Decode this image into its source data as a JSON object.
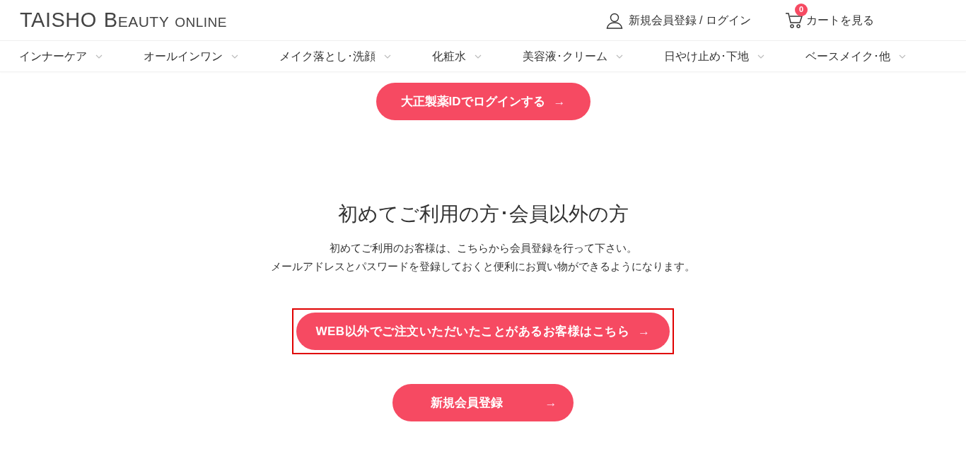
{
  "header": {
    "logo": {
      "main": "TAISHO",
      "beauty_initial": "B",
      "beauty_rest": "EAUTY",
      "online": "ONLINE"
    },
    "account_link": "新規会員登録 / ログイン",
    "cart": {
      "label": "カートを見る",
      "count": "0"
    }
  },
  "nav": [
    {
      "label": "インナーケア"
    },
    {
      "label": "オールインワン"
    },
    {
      "label": "メイク落とし･洗顔"
    },
    {
      "label": "化粧水"
    },
    {
      "label": "美容液･クリーム"
    },
    {
      "label": "日やけ止め･下地"
    },
    {
      "label": "ベースメイク･他"
    }
  ],
  "login_button": {
    "label": "大正製薬IDでログインする",
    "arrow": "→"
  },
  "guest_section": {
    "title": "初めてご利用の方･会員以外の方",
    "lines": [
      "初めてご利用のお客様は、こちらから会員登録を行って下さい。",
      "メールアドレスとパスワードを登録しておくと便利にお買い物ができるようになります。"
    ],
    "buttons": [
      {
        "label": "WEB以外でご注文いただいたことがあるお客様はこちら",
        "arrow": "→",
        "highlighted": true
      },
      {
        "label": "新規会員登録",
        "arrow": "→",
        "highlighted": false
      }
    ]
  }
}
